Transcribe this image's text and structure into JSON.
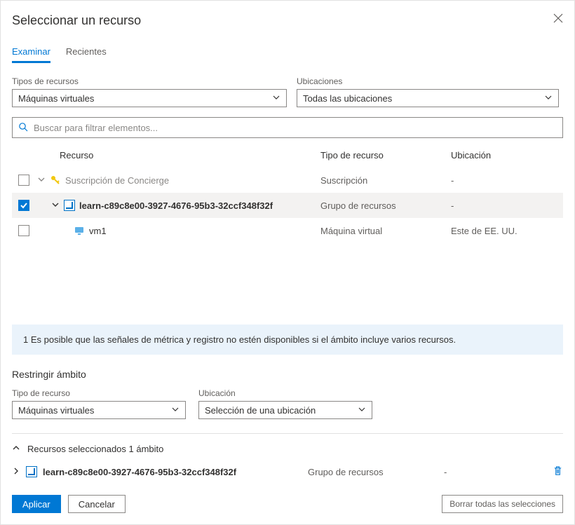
{
  "header": {
    "title": "Seleccionar un recurso"
  },
  "tabs": {
    "browse": "Examinar",
    "recent": "Recientes"
  },
  "filters": {
    "resource_types_label": "Tipos de recursos",
    "resource_types_value": "Máquinas virtuales",
    "locations_label": "Ubicaciones",
    "locations_value": "Todas las ubicaciones"
  },
  "search": {
    "placeholder": "Buscar para filtrar elementos..."
  },
  "table": {
    "columns": {
      "resource": "Recurso",
      "type": "Tipo de recurso",
      "location": "Ubicación"
    },
    "rows": [
      {
        "name": "Suscripción de Concierge",
        "type": "Suscripción",
        "location": "-",
        "checked": false,
        "level": 0,
        "icon": "key",
        "expanded": true,
        "disabled": true
      },
      {
        "name": "learn-c89c8e00-3927-4676-95b3-32ccf348f32f",
        "type": "Grupo de recursos",
        "location": "-",
        "checked": true,
        "level": 1,
        "icon": "rg",
        "expanded": true,
        "selected": true
      },
      {
        "name": "vm1",
        "type": "Máquina virtual",
        "location": "Este de EE. UU.",
        "checked": false,
        "level": 2,
        "icon": "vm"
      }
    ]
  },
  "info_banner": "1 Es posible que las señales de métrica y registro no estén disponibles si el ámbito incluye varios recursos.",
  "restrict": {
    "title": "Restringir ámbito",
    "rt_label": "Tipo de recurso",
    "rt_value": "Máquinas virtuales",
    "loc_label": "Ubicación",
    "loc_value": "Selección de una ubicación"
  },
  "selected": {
    "header": "Recursos seleccionados 1 ámbito",
    "items": [
      {
        "name": "learn-c89c8e00-3927-4676-95b3-32ccf348f32f",
        "type": "Grupo de recursos",
        "location": "-"
      }
    ]
  },
  "footer": {
    "apply": "Aplicar",
    "cancel": "Cancelar",
    "clear_all": "Borrar todas las selecciones"
  }
}
